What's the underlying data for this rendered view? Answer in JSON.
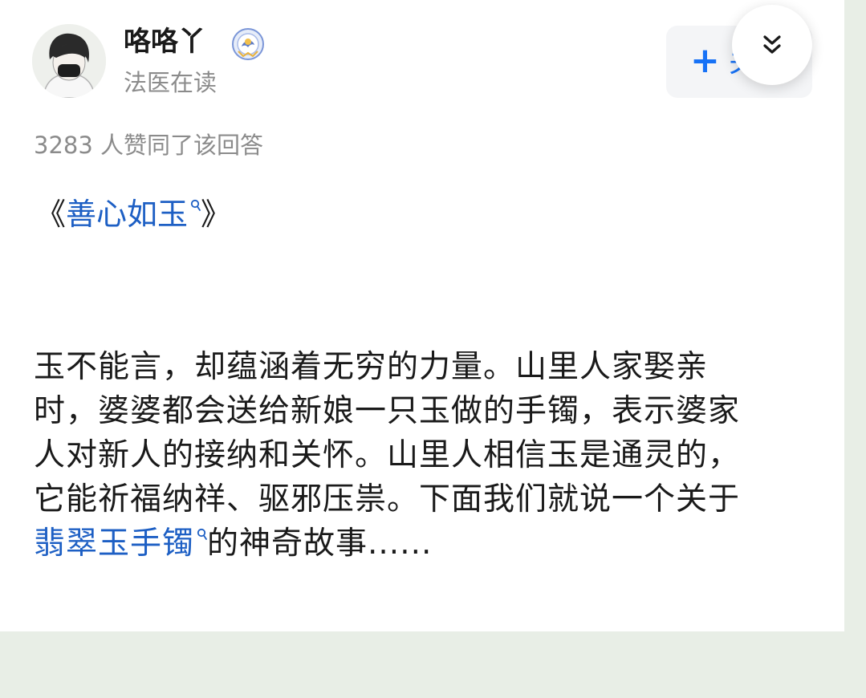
{
  "author": {
    "name": "咯咯丫",
    "subtitle": "法医在读",
    "avatar_icon": "user-avatar-icon",
    "badge_icon": "verified-badge-icon"
  },
  "follow_button": {
    "plus": "+",
    "label": "关"
  },
  "collapse_button": {
    "icon": "chevron-double-down-icon"
  },
  "vote_line": "3283 人赞同了该回答",
  "book_title": {
    "open_bracket": "《",
    "link_text": "善心如玉",
    "close_bracket": "》"
  },
  "paragraph": {
    "line1": "玉不能言，却蕴涵着无穷的力量。山里人家娶亲",
    "line2": "时，婆婆都会送给新娘一只玉做的手镯，表示婆家",
    "line3": "人对新人的接纳和关怀。山里人相信玉是通灵的，",
    "line4": "它能祈福纳祥、驱邪压祟。下面我们就说一个关于",
    "line5_link": "翡翠玉手镯",
    "line5_rest": "的神奇故事......"
  },
  "colors": {
    "link": "#1d5fc4",
    "accent": "#1772f6",
    "muted": "#8b8b8b",
    "page_bg": "#e8eee6"
  }
}
